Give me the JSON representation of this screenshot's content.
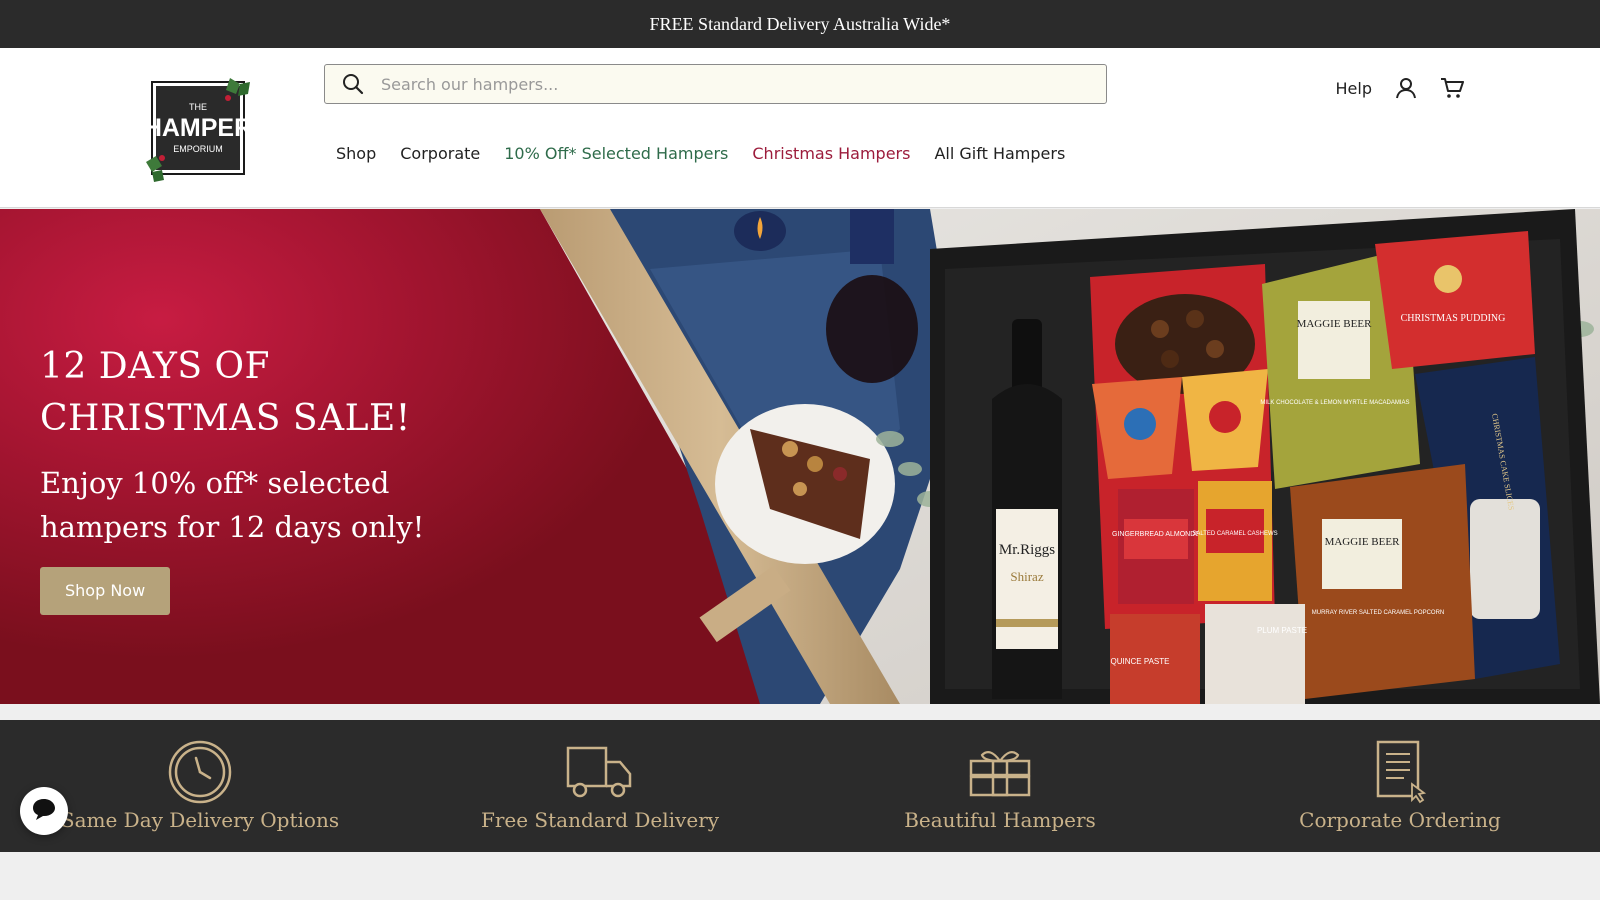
{
  "announcement": {
    "text": "FREE Standard Delivery Australia Wide*"
  },
  "logo": {
    "line1": "THE",
    "line2": "HAMPER",
    "line3": "EMPORIUM"
  },
  "search": {
    "placeholder": "Search our hampers..."
  },
  "utility": {
    "help_label": "Help",
    "account_icon": "user-icon",
    "cart_icon": "cart-icon"
  },
  "nav": {
    "items": [
      {
        "label": "Shop",
        "color": "#222222"
      },
      {
        "label": "Corporate",
        "color": "#222222"
      },
      {
        "label": "10% Off* Selected Hampers",
        "color": "#2e6b4a"
      },
      {
        "label": "Christmas Hampers",
        "color": "#9c1c3c"
      },
      {
        "label": "All Gift Hampers",
        "color": "#222222"
      }
    ]
  },
  "hero": {
    "title": "12 DAYS OF CHRISTMAS SALE!",
    "subtitle": "Enjoy 10% off* selected hampers for 12 days only!",
    "cta_label": "Shop Now",
    "cta_color": "#b5a27a",
    "product_text": {
      "wine_brand": "Mr.Riggs",
      "wine_type": "Shiraz",
      "brand": "MAGGIE BEER",
      "pudding": "CHRISTMAS PUDDING",
      "chocolate": "MILK CHOCOLATE & LEMON MYRTLE MACADAMIAS",
      "cake": "CHRISTMAS CAKE SLICES",
      "almonds": "GINGERBREAD ALMONDS",
      "cashews": "SALTED CARAMEL CASHEWS",
      "popcorn": "MURRAY RIVER SALTED CARAMEL POPCORN",
      "quince": "QUINCE PASTE",
      "plum": "PLUM PASTE"
    }
  },
  "features": [
    {
      "icon": "clock-icon",
      "label": "Same Day Delivery Options"
    },
    {
      "icon": "truck-icon",
      "label": "Free Standard Delivery"
    },
    {
      "icon": "gift-box-icon",
      "label": "Beautiful Hampers"
    },
    {
      "icon": "document-icon",
      "label": "Corporate Ordering"
    }
  ],
  "chat": {
    "icon": "chat-bubble-icon"
  },
  "colors": {
    "dark": "#2b2b2b",
    "accent_gold": "#c9b28a",
    "hero_red": "#a51531"
  }
}
